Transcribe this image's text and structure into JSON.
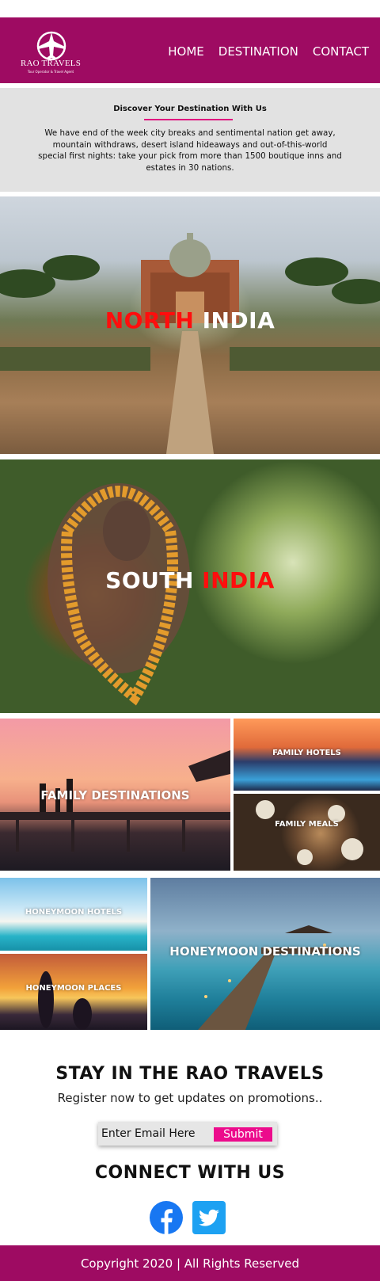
{
  "brand": {
    "name": "RAO TRAVELS",
    "tagline": "Tour Operator & Travel Agent"
  },
  "nav": {
    "items": [
      "HOME",
      "DESTINATION",
      "CONTACT"
    ]
  },
  "intro": {
    "title": "Discover Your Destination With Us",
    "body": "We have end of the week city breaks and sentimental nation get away, mountain withdraws, desert island hideaways and out-of-this-world special first nights: take your pick from more than 1500 boutique inns and estates in 30 nations."
  },
  "heroes": {
    "north": {
      "word1": "NORTH",
      "word2": "INDIA"
    },
    "south": {
      "word1": "SOUTH",
      "word2": "INDIA"
    }
  },
  "tiles": {
    "family_destinations": "FAMILY DESTINATIONS",
    "family_hotels": "FAMILY HOTELS",
    "family_meals": "FAMILY MEALS",
    "honeymoon_hotels": "HONEYMOON HOTELS",
    "honeymoon_places": "HONEYMOON PLACES",
    "honeymoon_destinations": "HONEYMOON DESTINATIONS"
  },
  "newsletter": {
    "title": "STAY IN THE RAO TRAVELS",
    "subtitle": "Register now to get updates on promotions..",
    "email_placeholder": "Enter Email Here",
    "submit_label": "Submit"
  },
  "social": {
    "title": "CONNECT WITH US",
    "icons": [
      "facebook-icon",
      "twitter-icon"
    ]
  },
  "footer": {
    "copyright": "Copyright 2020 | All Rights Reserved"
  },
  "colors": {
    "brand": "#9e0b62",
    "accent": "#ec0b8c",
    "red": "#ff0d0d",
    "facebook": "#1877f2",
    "twitter": "#1da1f2"
  }
}
